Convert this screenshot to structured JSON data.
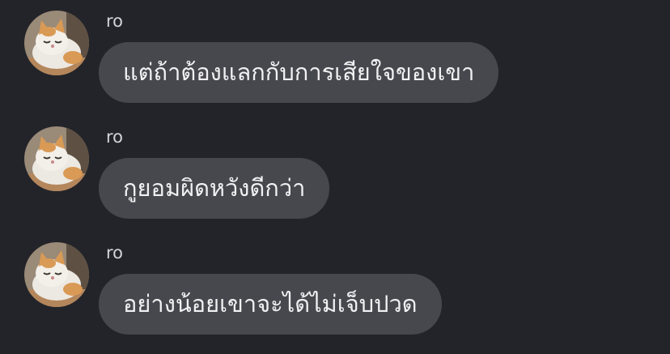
{
  "theme": {
    "background": "#232429",
    "bubble_color": "#47484e",
    "text_color": "#f1f1f3",
    "sender_color": "#d3d4d8"
  },
  "messages": [
    {
      "sender": "ro",
      "avatar_icon": "cat-avatar-icon",
      "text": "แต่ถ้าต้องแลกกับการเสียใจของเขา"
    },
    {
      "sender": "ro",
      "avatar_icon": "cat-avatar-icon",
      "text": "กูยอมผิดหวังดีกว่า"
    },
    {
      "sender": "ro",
      "avatar_icon": "cat-avatar-icon",
      "text": "อย่างน้อยเขาจะได้ไม่เจ็บปวด"
    }
  ]
}
